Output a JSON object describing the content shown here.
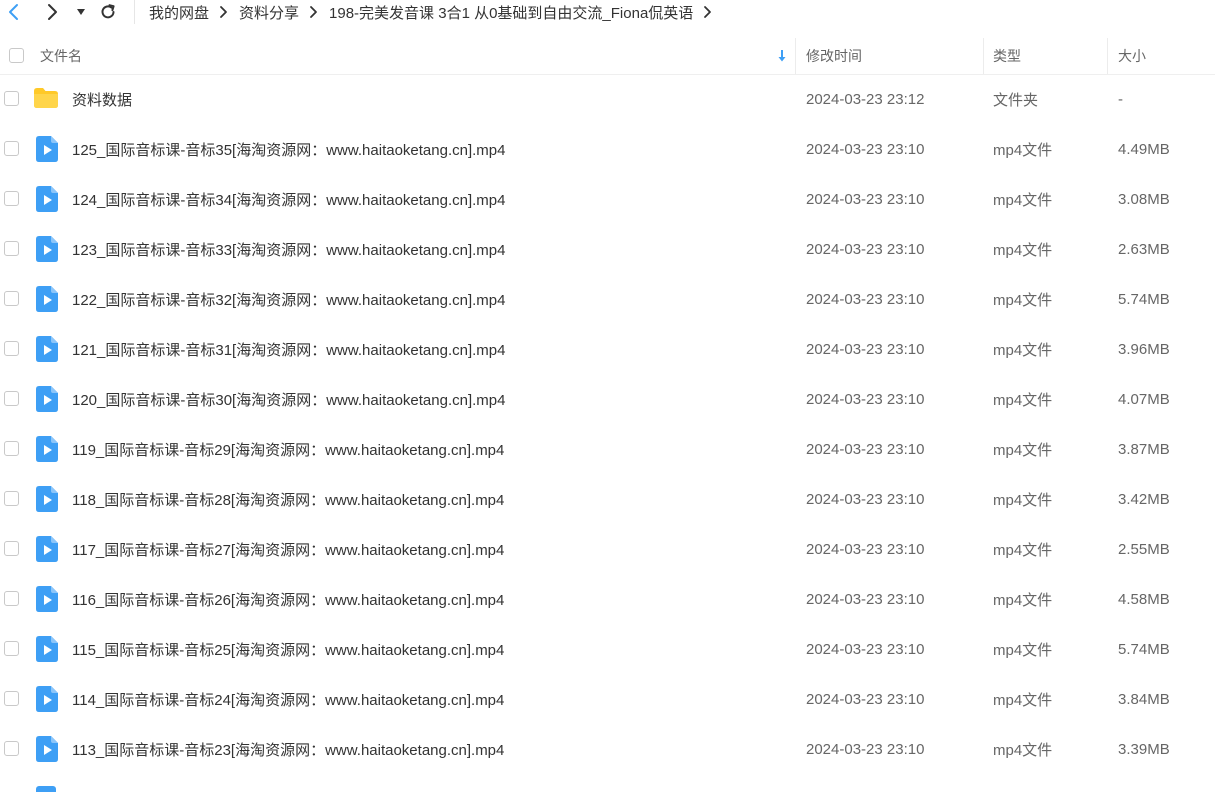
{
  "breadcrumb": [
    "我的网盘",
    "资料分享",
    "198-完美发音课 3合1 从0基础到自由交流_Fiona侃英语"
  ],
  "columns": {
    "name": "文件名",
    "modified": "修改时间",
    "type": "类型",
    "size": "大小"
  },
  "colors": {
    "accent": "#3e9ff5",
    "folder": "#ffc928"
  },
  "files": [
    {
      "name": "资料数据",
      "modified": "2024-03-23 23:12",
      "type": "文件夹",
      "size": "-",
      "icon": "folder-icon"
    },
    {
      "name": "125_国际音标课-音标35[海淘资源网：www.haitaoketang.cn].mp4",
      "modified": "2024-03-23 23:10",
      "type": "mp4文件",
      "size": "4.49MB",
      "icon": "video-file-icon"
    },
    {
      "name": "124_国际音标课-音标34[海淘资源网：www.haitaoketang.cn].mp4",
      "modified": "2024-03-23 23:10",
      "type": "mp4文件",
      "size": "3.08MB",
      "icon": "video-file-icon"
    },
    {
      "name": "123_国际音标课-音标33[海淘资源网：www.haitaoketang.cn].mp4",
      "modified": "2024-03-23 23:10",
      "type": "mp4文件",
      "size": "2.63MB",
      "icon": "video-file-icon"
    },
    {
      "name": "122_国际音标课-音标32[海淘资源网：www.haitaoketang.cn].mp4",
      "modified": "2024-03-23 23:10",
      "type": "mp4文件",
      "size": "5.74MB",
      "icon": "video-file-icon"
    },
    {
      "name": "121_国际音标课-音标31[海淘资源网：www.haitaoketang.cn].mp4",
      "modified": "2024-03-23 23:10",
      "type": "mp4文件",
      "size": "3.96MB",
      "icon": "video-file-icon"
    },
    {
      "name": "120_国际音标课-音标30[海淘资源网：www.haitaoketang.cn].mp4",
      "modified": "2024-03-23 23:10",
      "type": "mp4文件",
      "size": "4.07MB",
      "icon": "video-file-icon"
    },
    {
      "name": "119_国际音标课-音标29[海淘资源网：www.haitaoketang.cn].mp4",
      "modified": "2024-03-23 23:10",
      "type": "mp4文件",
      "size": "3.87MB",
      "icon": "video-file-icon"
    },
    {
      "name": "118_国际音标课-音标28[海淘资源网：www.haitaoketang.cn].mp4",
      "modified": "2024-03-23 23:10",
      "type": "mp4文件",
      "size": "3.42MB",
      "icon": "video-file-icon"
    },
    {
      "name": "117_国际音标课-音标27[海淘资源网：www.haitaoketang.cn].mp4",
      "modified": "2024-03-23 23:10",
      "type": "mp4文件",
      "size": "2.55MB",
      "icon": "video-file-icon"
    },
    {
      "name": "116_国际音标课-音标26[海淘资源网：www.haitaoketang.cn].mp4",
      "modified": "2024-03-23 23:10",
      "type": "mp4文件",
      "size": "4.58MB",
      "icon": "video-file-icon"
    },
    {
      "name": "115_国际音标课-音标25[海淘资源网：www.haitaoketang.cn].mp4",
      "modified": "2024-03-23 23:10",
      "type": "mp4文件",
      "size": "5.74MB",
      "icon": "video-file-icon"
    },
    {
      "name": "114_国际音标课-音标24[海淘资源网：www.haitaoketang.cn].mp4",
      "modified": "2024-03-23 23:10",
      "type": "mp4文件",
      "size": "3.84MB",
      "icon": "video-file-icon"
    },
    {
      "name": "113_国际音标课-音标23[海淘资源网：www.haitaoketang.cn].mp4",
      "modified": "2024-03-23 23:10",
      "type": "mp4文件",
      "size": "3.39MB",
      "icon": "video-file-icon"
    }
  ]
}
